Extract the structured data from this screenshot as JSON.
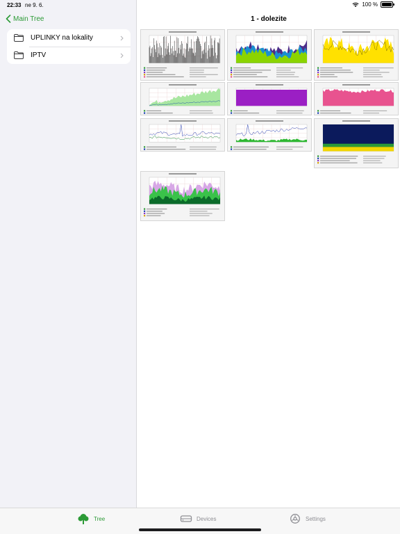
{
  "status": {
    "time": "22:33",
    "date": "ne 9. 6.",
    "battery": "100 %"
  },
  "sidebar": {
    "back_label": "Main Tree",
    "folders": [
      {
        "label": "UPLINKY na lokality"
      },
      {
        "label": "IPTV"
      }
    ]
  },
  "main": {
    "title": "1 - dolezite"
  },
  "graphs": [
    {
      "title": "Obvod OK 253 - Inbound Ping",
      "style": "spikes-black"
    },
    {
      "title": "Zaroj RED CELLRAI",
      "style": "area-green-purple"
    },
    {
      "title": "Unicast Packets - Unicast Packets - traffic",
      "style": "area-yellow"
    },
    {
      "title": "Inbound Traffic - unhide stacked",
      "style": "area-lightgreen"
    },
    {
      "title": "Impairment pocitacu - Hopfeld",
      "style": "block-purple"
    },
    {
      "title": "Umdi Router - CPU Usage",
      "style": "block-pink"
    },
    {
      "title": "Agregacia traffic - Traffic traffic",
      "style": "lines-blue-spike"
    },
    {
      "title": "Agregacia traffic - traffic 2 Ethernet",
      "style": "lines-blue-green"
    },
    {
      "title": "Agregacni CPU traffic load",
      "style": "block-navy-stack"
    },
    {
      "title": "Agregace vs EBx & XM",
      "style": "area-multi"
    }
  ],
  "tabs": [
    {
      "label": "Tree"
    },
    {
      "label": "Devices"
    },
    {
      "label": "Settings"
    }
  ],
  "colors": {
    "accent": "#2c9a36",
    "inactive": "#8e8e93"
  }
}
